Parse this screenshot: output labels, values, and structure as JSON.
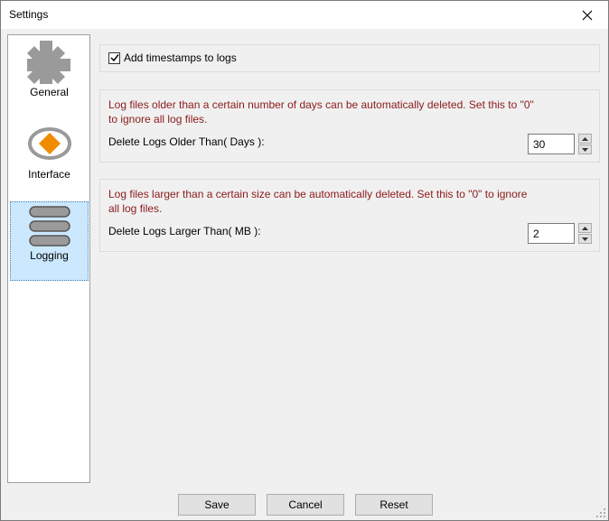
{
  "window": {
    "title": "Settings"
  },
  "sidebar": {
    "items": [
      {
        "label": "General",
        "icon": "puzzle-icon",
        "active": false
      },
      {
        "label": "Interface",
        "icon": "eye-icon",
        "active": false
      },
      {
        "label": "Logging",
        "icon": "log-stack-icon",
        "active": true
      }
    ]
  },
  "options": {
    "timestamps": {
      "label": "Add timestamps to logs",
      "checked": true
    },
    "days": {
      "description": "Log files older than a certain number of days can be automatically deleted. Set this to \"0\"\n to ignore all log files.",
      "label": "Delete Logs Older Than( Days ):",
      "value": "30"
    },
    "size": {
      "description": "Log files larger than a certain size can be automatically deleted. Set this to \"0\" to ignore\nall log files.",
      "label": "Delete Logs Larger Than( MB ):",
      "value": "2"
    }
  },
  "buttons": {
    "save": "Save",
    "cancel": "Cancel",
    "reset": "Reset"
  },
  "colors": {
    "description_text": "#8b1a1a",
    "selection_bg": "#cce8ff",
    "accent_orange": "#f08c00"
  }
}
